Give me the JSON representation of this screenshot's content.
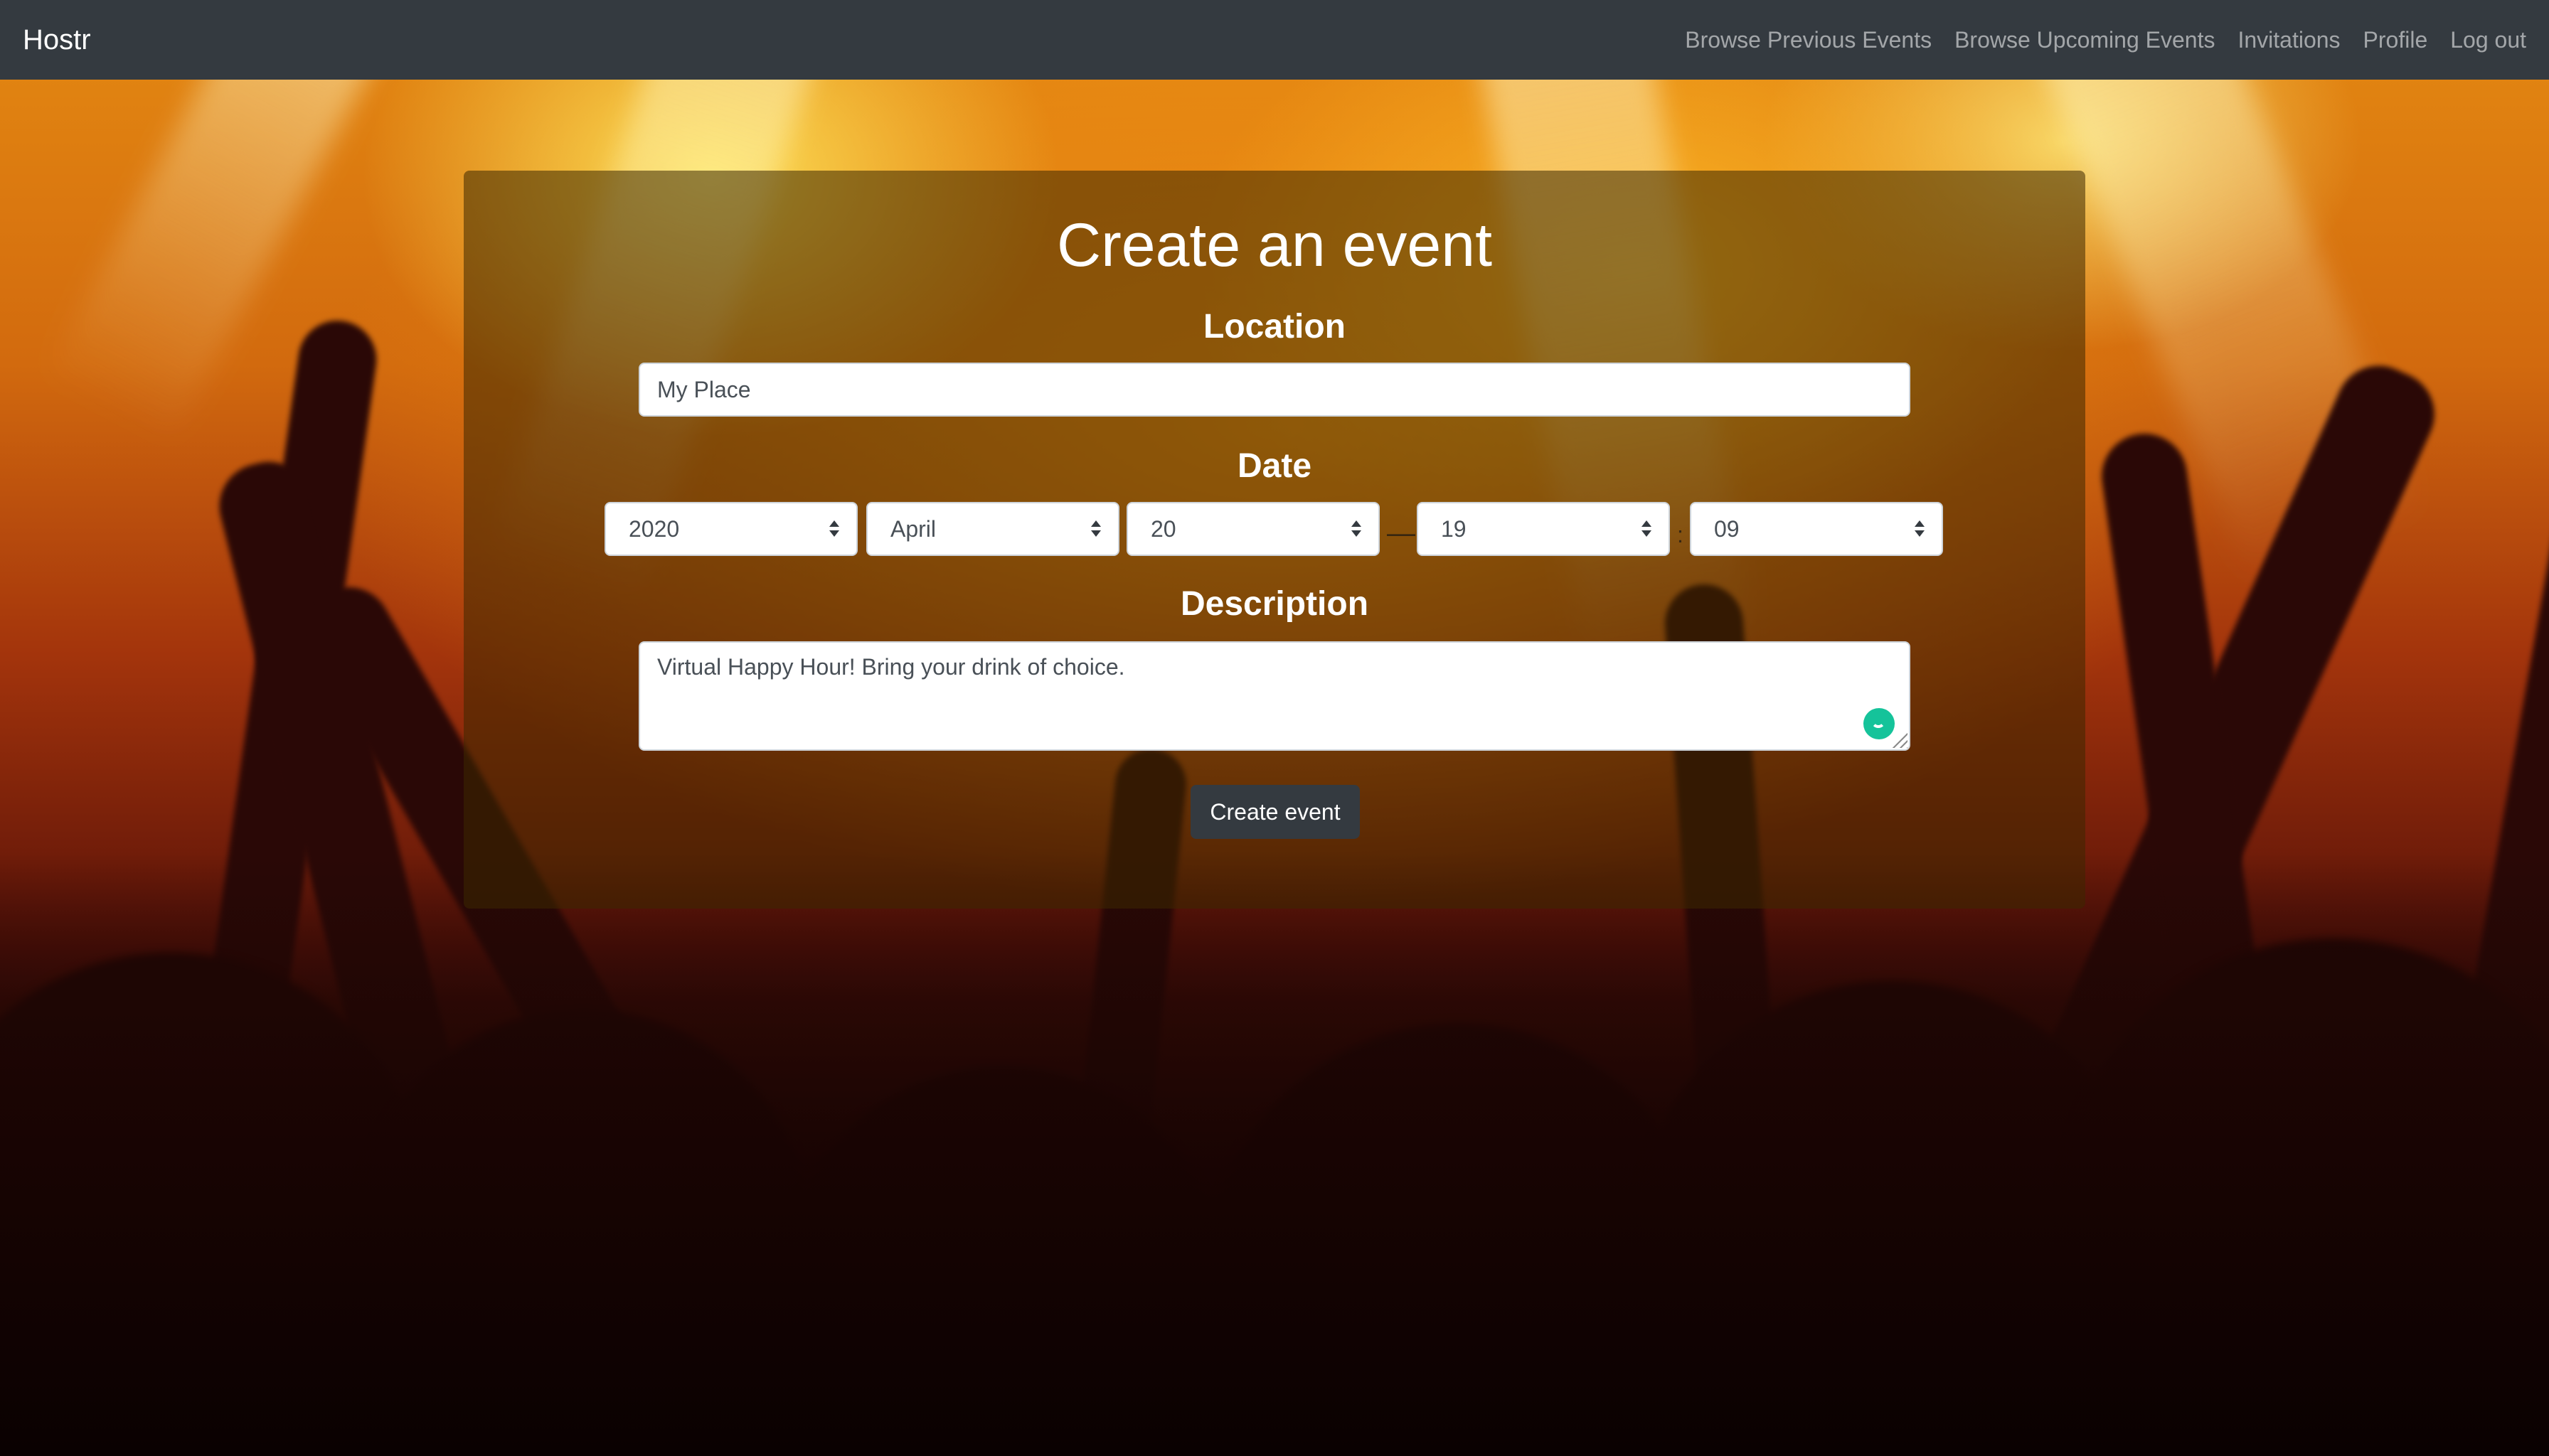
{
  "navbar": {
    "brand": "Hostr",
    "links": [
      {
        "label": "Browse Previous Events"
      },
      {
        "label": "Browse Upcoming Events"
      },
      {
        "label": "Invitations"
      },
      {
        "label": "Profile"
      },
      {
        "label": "Log out"
      }
    ]
  },
  "form": {
    "title": "Create an event",
    "location": {
      "label": "Location",
      "value": "My Place"
    },
    "date": {
      "label": "Date",
      "year": "2020",
      "month": "April",
      "day": "20",
      "hour": "19",
      "minute": "09",
      "separator": "—",
      "time_separator": ":"
    },
    "description": {
      "label": "Description",
      "value": "Virtual Happy Hour! Bring your drink of choice."
    },
    "submit_label": "Create event"
  },
  "icons": {
    "select_arrows": "chevron-up-down-icon",
    "grammar_assistant": "grammarly-icon",
    "resize": "resize-handle-icon"
  },
  "colors": {
    "navbar_bg": "#343a40",
    "button_bg": "#343a40",
    "grammar_icon": "#15c39a"
  }
}
